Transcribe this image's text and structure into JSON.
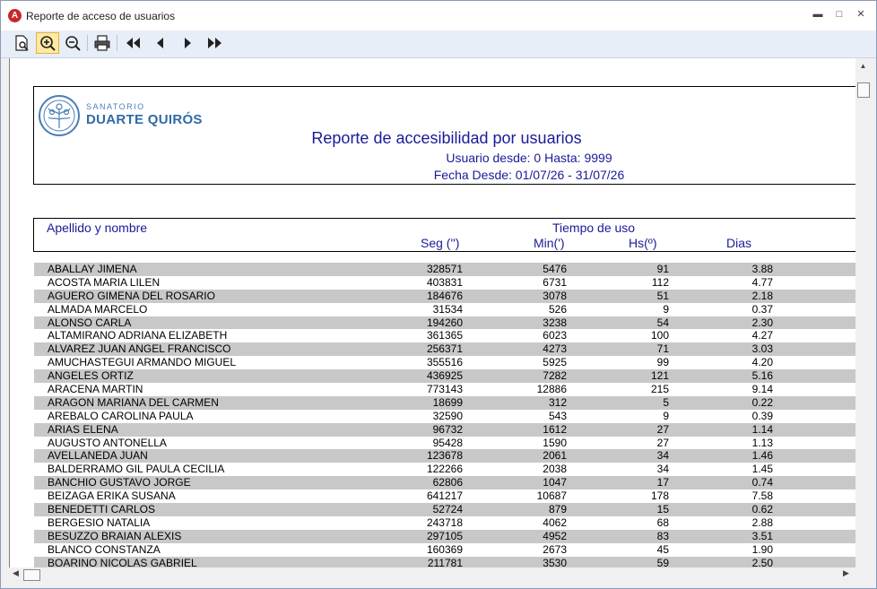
{
  "window": {
    "title": "Reporte de acceso de usuarios",
    "minimize": "▬",
    "maximize": "□",
    "close": "✕"
  },
  "toolbar": {
    "icons": [
      "page-setup-icon",
      "zoom-in-icon",
      "zoom-out-icon",
      "print-icon",
      "first-page-icon",
      "prev-page-icon",
      "next-page-icon",
      "last-page-icon"
    ]
  },
  "report": {
    "logo_small": "SANATORIO",
    "logo_big": "DUARTE QUIRÓS",
    "title": "Reporte de accesibilidad por usuarios",
    "subtitle_users": "Usuario desde: 0 Hasta: 9999",
    "subtitle_dates": "Fecha Desde: 01/07/26 - 31/07/26",
    "columns": {
      "name": "Apellido y nombre",
      "group": "Tiempo de uso",
      "seg": "Seg ('')",
      "min": "Min(')",
      "hs": "Hs(º)",
      "dias": "Dias"
    },
    "rows": [
      {
        "name": "ABALLAY JIMENA",
        "seg": "328571",
        "min": "5476",
        "hs": "91",
        "dias": "3.88"
      },
      {
        "name": "ACOSTA MARIA LILEN",
        "seg": "403831",
        "min": "6731",
        "hs": "112",
        "dias": "4.77"
      },
      {
        "name": "AGUERO GIMENA DEL ROSARIO",
        "seg": "184676",
        "min": "3078",
        "hs": "51",
        "dias": "2.18"
      },
      {
        "name": "ALMADA MARCELO",
        "seg": "31534",
        "min": "526",
        "hs": "9",
        "dias": "0.37"
      },
      {
        "name": "ALONSO CARLA",
        "seg": "194260",
        "min": "3238",
        "hs": "54",
        "dias": "2.30"
      },
      {
        "name": "ALTAMIRANO ADRIANA ELIZABETH",
        "seg": "361365",
        "min": "6023",
        "hs": "100",
        "dias": "4.27"
      },
      {
        "name": "ALVAREZ JUAN ANGEL FRANCISCO",
        "seg": "256371",
        "min": "4273",
        "hs": "71",
        "dias": "3.03"
      },
      {
        "name": "AMUCHASTEGUI ARMANDO MIGUEL",
        "seg": "355516",
        "min": "5925",
        "hs": "99",
        "dias": "4.20"
      },
      {
        "name": "ANGELES ORTIZ",
        "seg": "436925",
        "min": "7282",
        "hs": "121",
        "dias": "5.16"
      },
      {
        "name": "ARACENA MARTIN",
        "seg": "773143",
        "min": "12886",
        "hs": "215",
        "dias": "9.14"
      },
      {
        "name": "ARAGON MARIANA DEL CARMEN",
        "seg": "18699",
        "min": "312",
        "hs": "5",
        "dias": "0.22"
      },
      {
        "name": "AREBALO CAROLINA PAULA",
        "seg": "32590",
        "min": "543",
        "hs": "9",
        "dias": "0.39"
      },
      {
        "name": "ARIAS ELENA",
        "seg": "96732",
        "min": "1612",
        "hs": "27",
        "dias": "1.14"
      },
      {
        "name": "AUGUSTO ANTONELLA",
        "seg": "95428",
        "min": "1590",
        "hs": "27",
        "dias": "1.13"
      },
      {
        "name": "AVELLANEDA JUAN",
        "seg": "123678",
        "min": "2061",
        "hs": "34",
        "dias": "1.46"
      },
      {
        "name": "BALDERRAMO GIL PAULA CECILIA",
        "seg": "122266",
        "min": "2038",
        "hs": "34",
        "dias": "1.45"
      },
      {
        "name": "BANCHIO GUSTAVO JORGE",
        "seg": "62806",
        "min": "1047",
        "hs": "17",
        "dias": "0.74"
      },
      {
        "name": "BEIZAGA ERIKA SUSANA",
        "seg": "641217",
        "min": "10687",
        "hs": "178",
        "dias": "7.58"
      },
      {
        "name": "BENEDETTI CARLOS",
        "seg": "52724",
        "min": "879",
        "hs": "15",
        "dias": "0.62"
      },
      {
        "name": "BERGESIO NATALIA",
        "seg": "243718",
        "min": "4062",
        "hs": "68",
        "dias": "2.88"
      },
      {
        "name": "BESUZZO BRAIAN ALEXIS",
        "seg": "297105",
        "min": "4952",
        "hs": "83",
        "dias": "3.51"
      },
      {
        "name": "BLANCO CONSTANZA",
        "seg": "160369",
        "min": "2673",
        "hs": "45",
        "dias": "1.90"
      },
      {
        "name": "BOARINO NICOLAS GABRIEL",
        "seg": "211781",
        "min": "3530",
        "hs": "59",
        "dias": "2.50"
      }
    ]
  }
}
